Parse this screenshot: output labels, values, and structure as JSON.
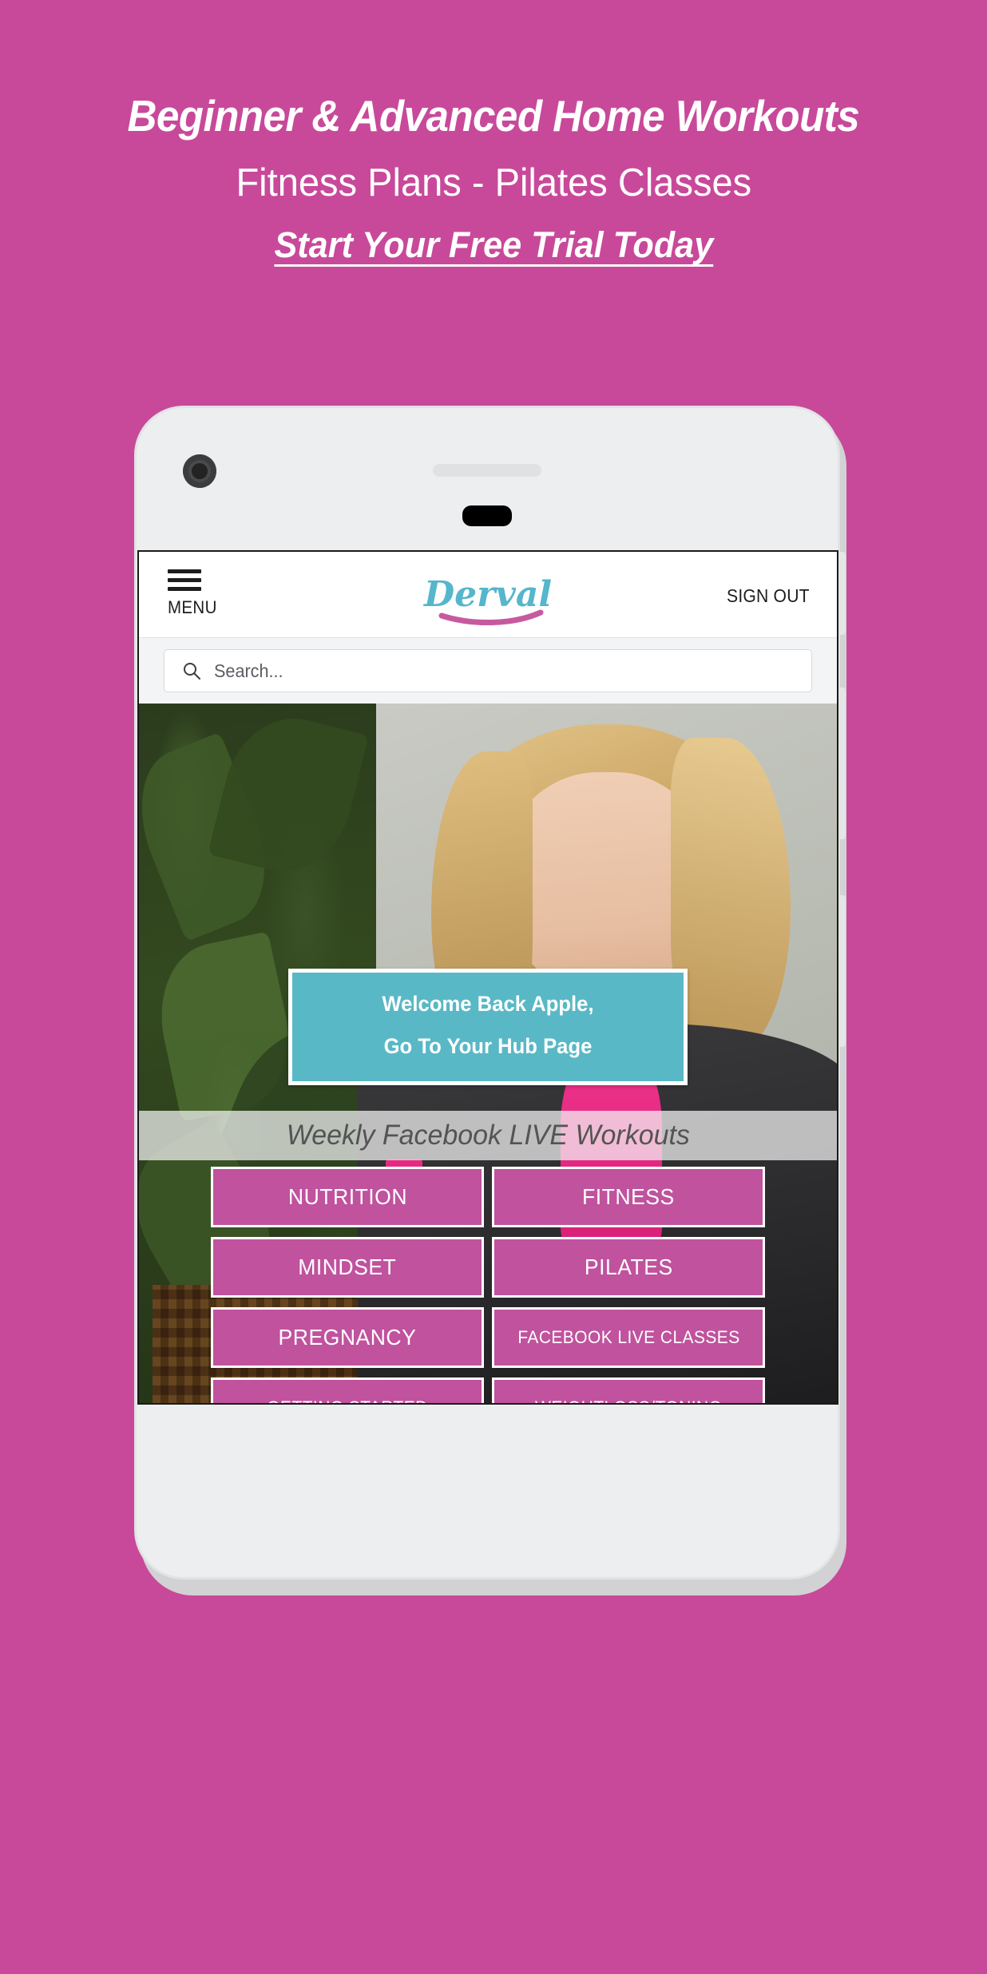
{
  "promo": {
    "line1": "Beginner & Advanced Home Workouts",
    "line2": "Fitness Plans - Pilates Classes",
    "line3": "Start Your Free Trial Today"
  },
  "colors": {
    "background_pink": "#c8499a",
    "button_pink": "#c0529e",
    "banner_teal": "#59b8c5",
    "logo_teal": "#55b6cc",
    "logo_swoosh_pink": "#c75a9e"
  },
  "app": {
    "header": {
      "menu_label": "MENU",
      "menu_icon": "hamburger-icon",
      "logo_text": "Derval",
      "sign_out_label": "SIGN OUT"
    },
    "search": {
      "placeholder": "Search...",
      "value": "",
      "icon": "search-icon"
    },
    "welcome_banner": {
      "line1": "Welcome Back Apple,",
      "line2": "Go To Your Hub Page"
    },
    "weekly_strip": {
      "label": "Weekly Facebook LIVE Workouts"
    },
    "nav_buttons": [
      {
        "label": "NUTRITION",
        "size": "large"
      },
      {
        "label": "FITNESS",
        "size": "large"
      },
      {
        "label": "MINDSET",
        "size": "large"
      },
      {
        "label": "PILATES",
        "size": "large"
      },
      {
        "label": "PREGNANCY",
        "size": "large"
      },
      {
        "label": "FACEBOOK LIVE CLASSES",
        "size": "small"
      },
      {
        "label": "GETTING STARTED",
        "size": "small"
      },
      {
        "label": "WEIGHTLOSS/TONING",
        "size": "small"
      }
    ]
  }
}
